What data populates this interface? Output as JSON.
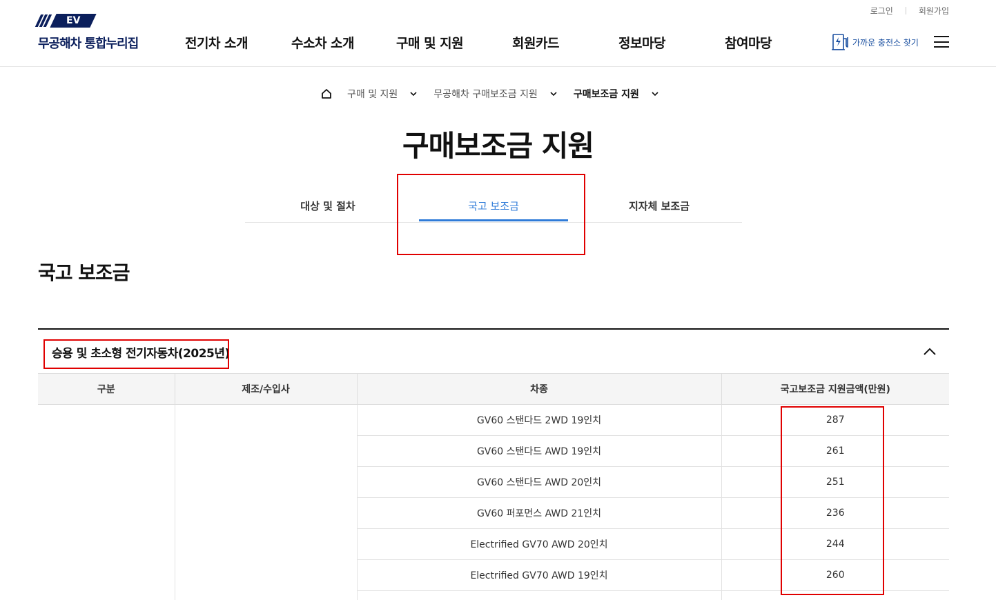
{
  "util": {
    "login": "로그인",
    "signup": "회원가입"
  },
  "logo": {
    "mark": "EV",
    "text": "무공해차 통합누리집"
  },
  "gnb": [
    "전기차 소개",
    "수소차 소개",
    "구매 및 지원",
    "회원카드",
    "정보마당",
    "참여마당"
  ],
  "charger_link": "가까운 충전소 찾기",
  "icons": {
    "home": "home-icon",
    "chevron": "chevron-down-icon",
    "charger": "ev-charger-icon",
    "menu": "hamburger-menu-icon",
    "collapse": "chevron-up-icon"
  },
  "breadcrumb": [
    "구매 및 지원",
    "무공해차 구매보조금 지원",
    "구매보조금 지원"
  ],
  "page_title": "구매보조금 지원",
  "tabs": [
    "대상 및 절차",
    "국고 보조금",
    "지자체 보조금"
  ],
  "section_title": "국고 보조금",
  "accordion_title": "승용 및 초소형 전기자동차(2025년)",
  "table": {
    "headers": [
      "구분",
      "제조/수입사",
      "차종",
      "국고보조금 지원금액(만원)"
    ],
    "rows": [
      {
        "model": "GV60 스탠다드 2WD 19인치",
        "amount": "287"
      },
      {
        "model": "GV60 스탠다드 AWD 19인치",
        "amount": "261"
      },
      {
        "model": "GV60 스탠다드 AWD 20인치",
        "amount": "251"
      },
      {
        "model": "GV60 퍼포먼스 AWD 21인치",
        "amount": "236"
      },
      {
        "model": "Electrified GV70 AWD 20인치",
        "amount": "244"
      },
      {
        "model": "Electrified GV70 AWD 19인치",
        "amount": "260"
      },
      {
        "model": "",
        "amount": ""
      }
    ]
  },
  "colors": {
    "brand": "#0b1f5c",
    "accent": "#2f7bd8",
    "highlight": "#e00000"
  }
}
